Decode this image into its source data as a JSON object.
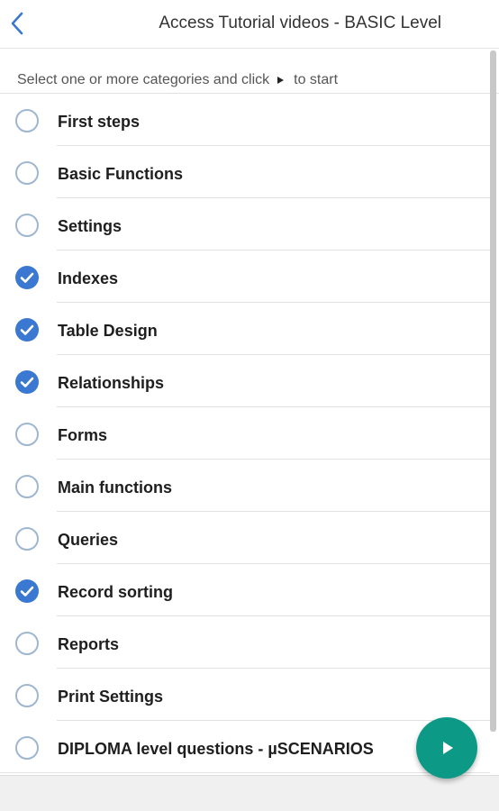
{
  "header": {
    "title": "Access Tutorial videos - BASIC Level",
    "back_icon": "chevron-left-icon"
  },
  "instruction": {
    "before": "Select one or more categories and click",
    "after": "to start",
    "icon": "play-icon"
  },
  "colors": {
    "accent": "#3a78d1",
    "fab": "#0c9a87",
    "unchecked_border": "#9fb6d3"
  },
  "categories": [
    {
      "label": "First steps",
      "checked": false
    },
    {
      "label": "Basic Functions",
      "checked": false
    },
    {
      "label": "Settings",
      "checked": false
    },
    {
      "label": "Indexes",
      "checked": true
    },
    {
      "label": "Table Design",
      "checked": true
    },
    {
      "label": "Relationships",
      "checked": true
    },
    {
      "label": "Forms",
      "checked": false
    },
    {
      "label": "Main functions",
      "checked": false
    },
    {
      "label": "Queries",
      "checked": false
    },
    {
      "label": "Record sorting",
      "checked": true
    },
    {
      "label": "Reports",
      "checked": false
    },
    {
      "label": "Print Settings",
      "checked": false
    },
    {
      "label": "DIPLOMA level questions - µSCENARIOS",
      "checked": false
    }
  ],
  "fab": {
    "icon": "play-icon"
  }
}
